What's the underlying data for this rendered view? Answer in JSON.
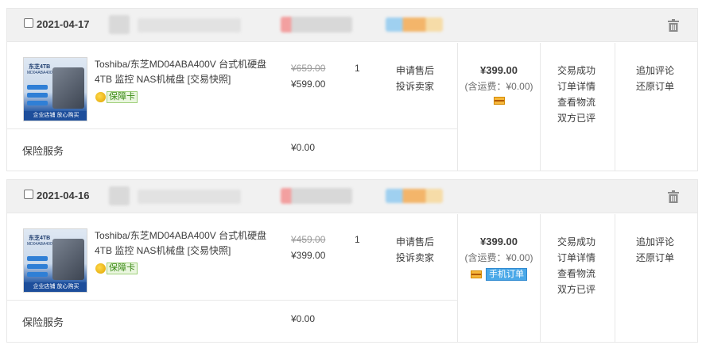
{
  "orders": [
    {
      "date": "2021-04-17",
      "thumb": {
        "line1": "东芝4TB",
        "line2": "MD04ABA400V",
        "footer": "企业店铺 放心购买"
      },
      "title": "Toshiba/东芝MD04ABA400V 台式机硬盘4TB 监控 NAS机械盘 [交易快照]",
      "badge": "保障卡",
      "original_price": "¥659.00",
      "price": "¥599.00",
      "quantity": "1",
      "service_links": [
        "申请售后",
        "投诉卖家"
      ],
      "total": "¥399.00",
      "shipping": "(含运费：¥0.00)",
      "mobile_tag": "",
      "status_links": [
        "交易成功",
        "订单详情",
        "查看物流",
        "双方已评"
      ],
      "action_links": [
        "追加评论",
        "还原订单"
      ],
      "insurance_label": "保险服务",
      "insurance_price": "¥0.00"
    },
    {
      "date": "2021-04-16",
      "thumb": {
        "line1": "东芝4TB",
        "line2": "MD04ABA400V",
        "footer": "企业店铺 放心购买"
      },
      "title": "Toshiba/东芝MD04ABA400V 台式机硬盘4TB 监控 NAS机械盘 [交易快照]",
      "badge": "保障卡",
      "original_price": "¥459.00",
      "price": "¥399.00",
      "quantity": "1",
      "service_links": [
        "申请售后",
        "投诉卖家"
      ],
      "total": "¥399.00",
      "shipping": "(含运费：¥0.00)",
      "mobile_tag": "手机订单",
      "status_links": [
        "交易成功",
        "订单详情",
        "查看物流",
        "双方已评"
      ],
      "action_links": [
        "追加评论",
        "还原订单"
      ],
      "insurance_label": "保险服务",
      "insurance_price": "¥0.00"
    }
  ],
  "icons": {
    "delete": "trash-icon",
    "payment": "card-icon",
    "badge": "shield-icon"
  },
  "colors": {
    "header_bg": "#f1f1f1",
    "border": "#e8e8e8",
    "badge_green": "#3a8a15",
    "mobile_blue": "#4aa8e8",
    "text": "#3c3c3c"
  }
}
